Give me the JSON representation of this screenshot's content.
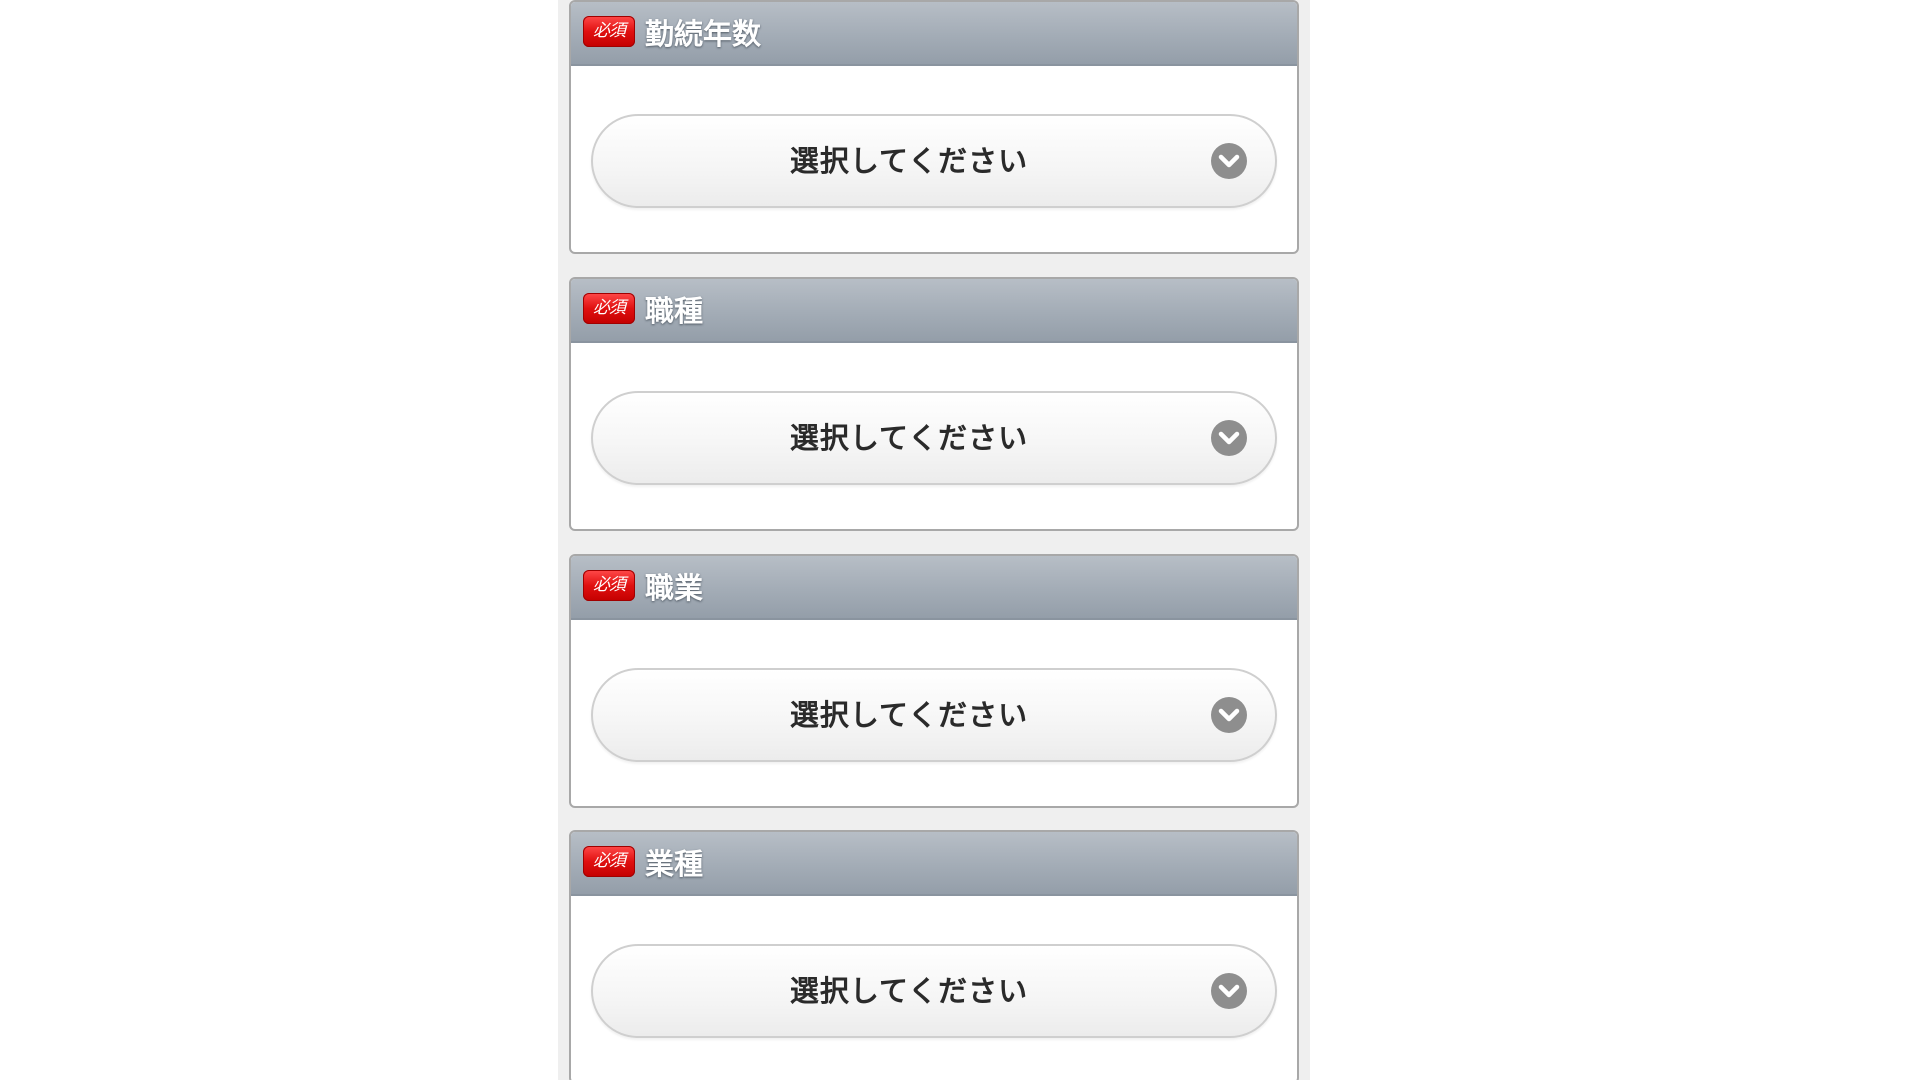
{
  "required_label": "必須",
  "sections": [
    {
      "title": "勤続年数",
      "select_value": "選択してください"
    },
    {
      "title": "職種",
      "select_value": "選択してください"
    },
    {
      "title": "職業",
      "select_value": "選択してください"
    },
    {
      "title": "業種",
      "select_value": "選択してください"
    }
  ],
  "icons": {
    "dropdown": "chevron-down-icon"
  },
  "colors": {
    "header_bg": "#a3acb6",
    "badge_red": "#e01010",
    "chevron_bg": "#8e8e8e"
  }
}
